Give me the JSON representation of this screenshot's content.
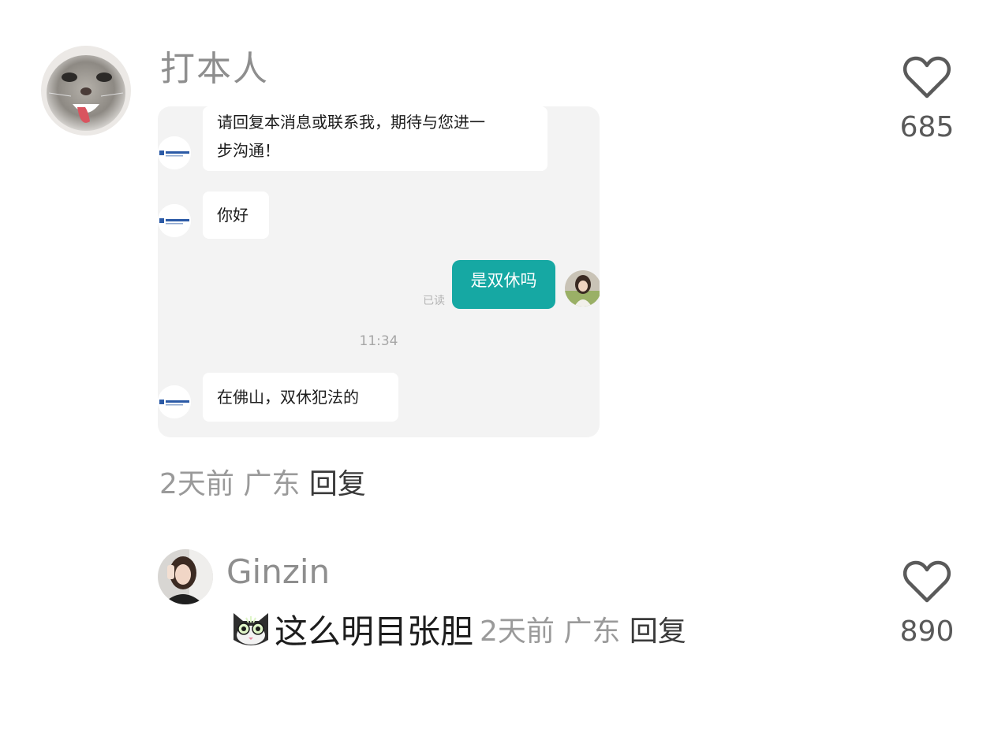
{
  "comments": [
    {
      "username": "打本人",
      "likes": "685",
      "time": "2天前",
      "location": "广东",
      "reply_label": "回复",
      "image": {
        "messages": [
          {
            "line1": "请回复本消息或联系我，期待与您进一",
            "line2": "步沟通！"
          },
          {
            "text": "你好"
          },
          {
            "text": "是双休吗",
            "status": "已读"
          },
          {
            "time": "11:34"
          },
          {
            "text": "在佛山，双休犯法的"
          }
        ]
      }
    },
    {
      "username": "Ginzin",
      "text": "这么明目张胆",
      "likes": "890",
      "time": "2天前",
      "location": "广东",
      "reply_label": "回复"
    }
  ],
  "icons": {
    "like": "heart-outline-icon",
    "emoji": "cat-emoji-icon"
  },
  "colors": {
    "accent_bubble": "#16a8a3",
    "username": "#8e8e8e",
    "meta": "#9a9a9a"
  }
}
